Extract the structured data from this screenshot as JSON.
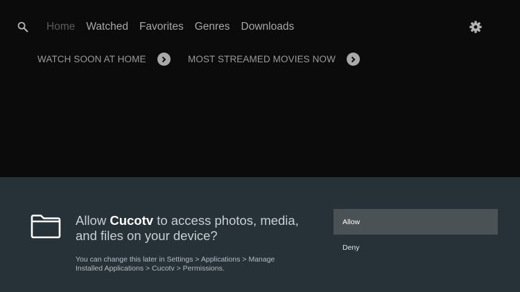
{
  "nav": {
    "items": [
      "Home",
      "Watched",
      "Favorites",
      "Genres",
      "Downloads"
    ],
    "active_index": 0
  },
  "rows": [
    {
      "title": "WATCH SOON AT HOME"
    },
    {
      "title": "MOST STREAMED MOVIES NOW"
    }
  ],
  "dialog": {
    "prompt_prefix": "Allow ",
    "app_name": "Cucotv",
    "prompt_suffix": " to access photos, media, and files on your device?",
    "note": "You can change this later in Settings > Applications > Manage Installed Applications > Cucotv > Permissions.",
    "allow_label": "Allow",
    "deny_label": "Deny"
  },
  "icons": {
    "search": "search-icon",
    "settings": "gear-icon",
    "row_arrow": "chevron-right-icon",
    "permission": "folder-icon"
  },
  "colors": {
    "background": "#0b0b0b",
    "dialog_background": "#263238",
    "selected_option": "#4a5255",
    "nav_text": "#a7a7a7",
    "nav_active_text": "#5c5c5c"
  }
}
